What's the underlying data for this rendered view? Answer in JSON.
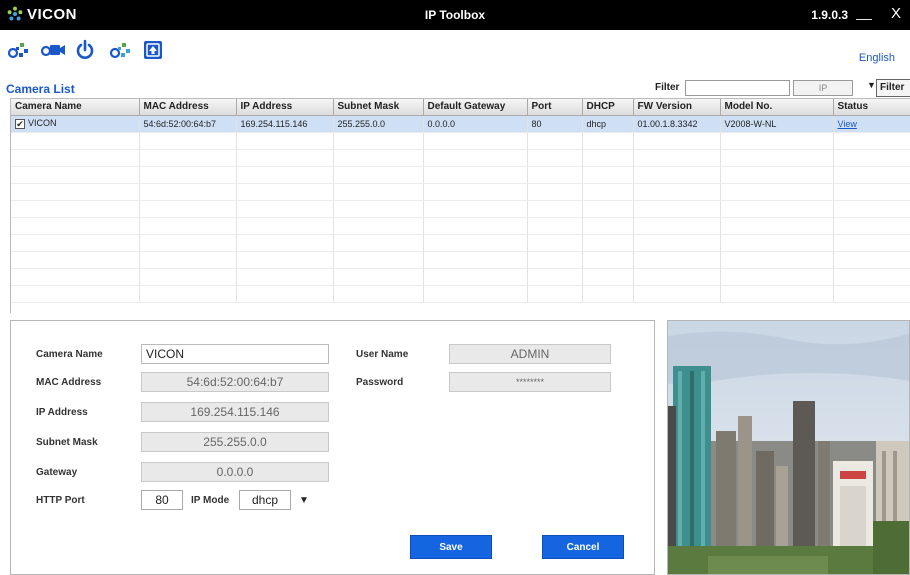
{
  "titlebar": {
    "logo_text": "VICON",
    "app_title": "IP Toolbox",
    "version": "1.9.0.3",
    "minimize": "__",
    "close": "X"
  },
  "toolbar": {
    "icons": [
      "search-devices-icon",
      "camera-icon",
      "power-icon",
      "network-config-icon",
      "update-icon"
    ],
    "language": "English"
  },
  "camera_list": {
    "title": "Camera List",
    "filter_label": "Filter",
    "filter_value": "",
    "filter_type": "IP",
    "filter_button": "Filter",
    "columns": [
      "Camera Name",
      "MAC Address",
      "IP Address",
      "Subnet Mask",
      "Default Gateway",
      "Port",
      "DHCP",
      "FW Version",
      "Model No.",
      "Status"
    ],
    "rows": [
      {
        "checked": true,
        "camera_name": "VICON",
        "mac": "54:6d:52:00:64:b7",
        "ip": "169.254.115.146",
        "subnet": "255.255.0.0",
        "gateway": "0.0.0.0",
        "port": "80",
        "dhcp": "dhcp",
        "fw": "01.00.1.8.3342",
        "model": "V2008-W-NL",
        "status": "View"
      }
    ]
  },
  "details": {
    "camera_name_label": "Camera Name",
    "camera_name": "VICON",
    "mac_label": "MAC Address",
    "mac": "54:6d:52:00:64:b7",
    "ip_label": "IP Address",
    "ip": "169.254.115.146",
    "subnet_label": "Subnet Mask",
    "subnet": "255.255.0.0",
    "gateway_label": "Gateway",
    "gateway": "0.0.0.0",
    "http_port_label": "HTTP Port",
    "http_port": "80",
    "ip_mode_label": "IP Mode",
    "ip_mode": "dhcp",
    "user_name_label": "User Name",
    "user_name": "ADMIN",
    "password_label": "Password",
    "password": "********",
    "save": "Save",
    "cancel": "Cancel"
  },
  "colors": {
    "accent": "#1a57c8",
    "button": "#1565e0",
    "selected_row": "#cfe0f6",
    "titlebar": "#000000"
  }
}
